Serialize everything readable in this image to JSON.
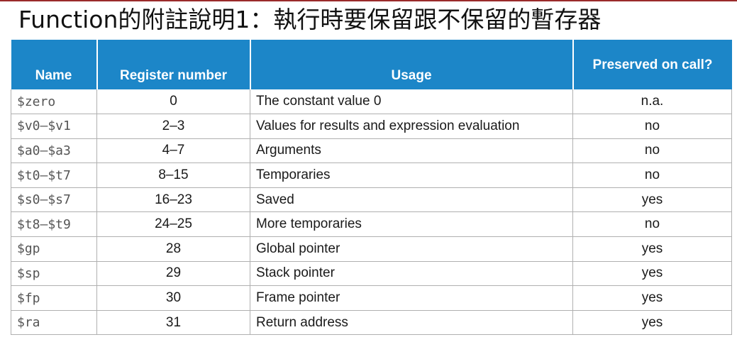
{
  "slide": {
    "title": "Function的附註說明1：執行時要保留跟不保留的暫存器"
  },
  "table": {
    "headers": {
      "name": "Name",
      "register_number": "Register number",
      "usage": "Usage",
      "preserved": "Preserved on call?"
    },
    "rows": [
      {
        "name": "$zero",
        "number": "0",
        "usage": "The constant value 0",
        "preserved": "n.a."
      },
      {
        "name": "$v0–$v1",
        "number": "2–3",
        "usage": "Values for results and expression evaluation",
        "preserved": "no"
      },
      {
        "name": "$a0–$a3",
        "number": "4–7",
        "usage": "Arguments",
        "preserved": "no"
      },
      {
        "name": "$t0–$t7",
        "number": "8–15",
        "usage": "Temporaries",
        "preserved": "no"
      },
      {
        "name": "$s0–$s7",
        "number": "16–23",
        "usage": "Saved",
        "preserved": "yes"
      },
      {
        "name": "$t8–$t9",
        "number": "24–25",
        "usage": "More temporaries",
        "preserved": "no"
      },
      {
        "name": "$gp",
        "number": "28",
        "usage": "Global pointer",
        "preserved": "yes"
      },
      {
        "name": "$sp",
        "number": "29",
        "usage": "Stack pointer",
        "preserved": "yes"
      },
      {
        "name": "$fp",
        "number": "30",
        "usage": "Frame pointer",
        "preserved": "yes"
      },
      {
        "name": "$ra",
        "number": "31",
        "usage": "Return address",
        "preserved": "yes"
      }
    ]
  },
  "colors": {
    "header_bg": "#1c86c8",
    "header_text": "#ffffff",
    "grid": "#b0b0b0"
  }
}
